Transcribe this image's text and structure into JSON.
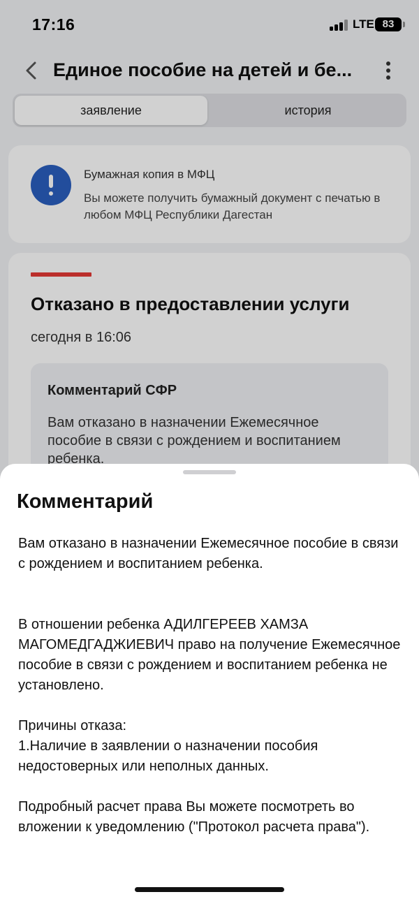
{
  "status_bar": {
    "time": "17:16",
    "network": "LTE",
    "battery": "83"
  },
  "nav": {
    "title": "Единое пособие на детей и бе...",
    "back_icon": "chevron-left-icon",
    "more_icon": "more-vertical-icon"
  },
  "tabs": [
    {
      "label": "заявление",
      "active": true
    },
    {
      "label": "история",
      "active": false
    }
  ],
  "info_card": {
    "icon": "exclamation-icon",
    "title": "Бумажная копия в МФЦ",
    "text": "Вы можете получить бумажный документ с печатью в любом МФЦ Республики Дагестан"
  },
  "status_card": {
    "heading": "Отказано в предоставлении услуги",
    "time": "сегодня в 16:06",
    "comment_title": "Комментарий СФР",
    "comment_text": "Вам отказано в назначении Ежемесячное пособие в связи с рождением и воспитанием ребенка."
  },
  "sheet": {
    "title": "Комментарий",
    "body": "Вам отказано в назначении Ежемесячное пособие в связи с рождением и воспитанием ребенка.\n\n\nВ отношении ребенка АДИЛГЕРЕЕВ ХАМЗА МАГОМЕДГАДЖИЕВИЧ право на получение Ежемесячное пособие в связи с рождением и воспитанием ребенка не установлено.\n\nПричины отказа:\n1.Наличие в заявлении о назначении пособия недостоверных или неполных данных.\n\nПодробный расчет права Вы можете посмотреть во вложении к уведомлению (\"Протокол расчета права\")."
  },
  "colors": {
    "accent_blue": "#2a5fbf",
    "status_red": "#e53935"
  }
}
